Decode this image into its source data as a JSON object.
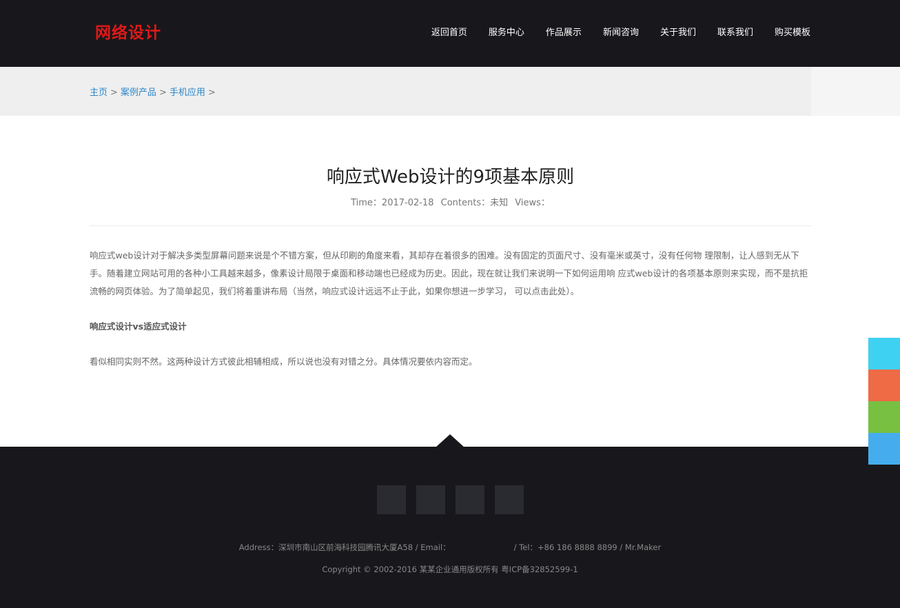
{
  "header": {
    "logo": "网络设计",
    "nav": [
      "返回首页",
      "服务中心",
      "作品展示",
      "新闻咨询",
      "关于我们",
      "联系我们",
      "购买模板"
    ]
  },
  "breadcrumb": {
    "items": [
      "主页",
      "案例产品",
      "手机应用"
    ],
    "separator": ">"
  },
  "article": {
    "title": "响应式Web设计的9项基本原则",
    "time": "Time：2017-02-18",
    "contents": "Contents：未知",
    "views": "Views：",
    "paragraph1": "响应式web设计对于解决多类型屏幕问题来说是个不错方案，但从印刷的角度来看，其却存在着很多的困难。没有固定的页面尺寸、没有毫米或英寸，没有任何物 理限制，让人感到无从下手。随着建立网站可用的各种小工具越来越多，像素设计局限于桌面和移动端也已经成为历史。因此，现在就让我们来说明一下如何运用响 应式web设计的各项基本原则来实现，而不是抗拒流畅的网页体验。为了简单起见，我们将着重讲布局（当然，响应式设计远远不止于此，如果你想进一步学习， 可以点击此处）。",
    "heading": "响应式设计vs适应式设计",
    "paragraph2": "看似相同实则不然。这两种设计方式彼此相辅相成，所以说也没有对错之分。具体情况要依内容而定。"
  },
  "footer": {
    "address": "Address：深圳市南山区前海科技园腾讯大厦A58 / Email：",
    "tel": "/ Tel：+86 186 8888 8899 / Mr.Maker",
    "copyright": "Copyright © 2002-2016 某某企业通用版权所有  粤ICP备32852599-1"
  },
  "colors": {
    "header_bg": "#18181c",
    "logo": "#e01818",
    "link": "#2c86c8",
    "side_buttons": [
      "#3fd1f2",
      "#ee6b45",
      "#77c042",
      "#45adee"
    ]
  }
}
